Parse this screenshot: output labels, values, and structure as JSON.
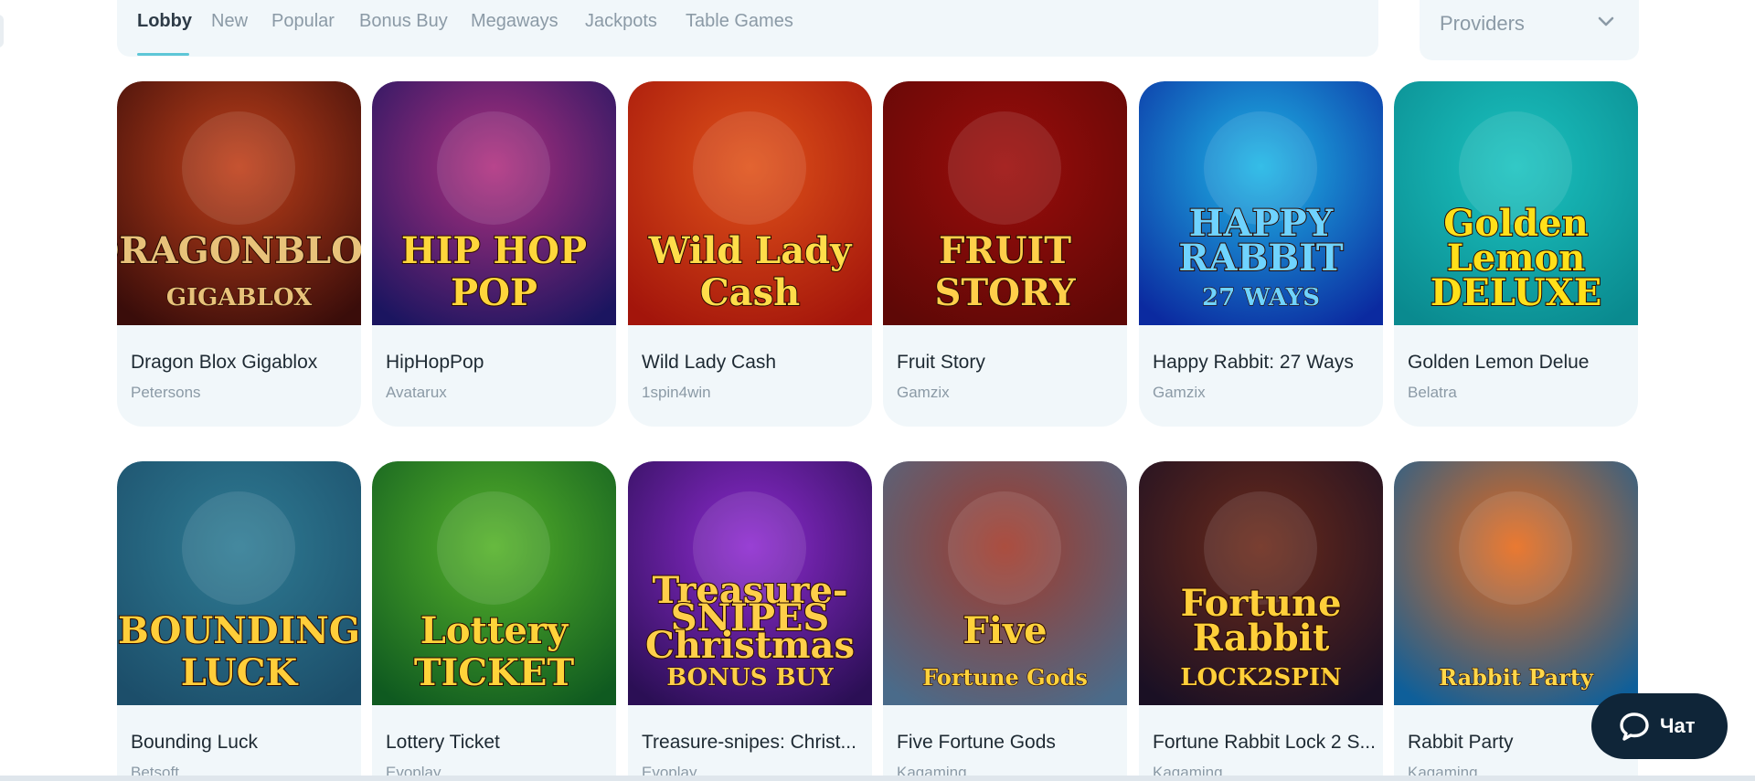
{
  "tabs": [
    {
      "label": "Lobby",
      "active": true
    },
    {
      "label": "New"
    },
    {
      "label": "Popular"
    },
    {
      "label": "Bonus Buy"
    },
    {
      "label": "Megaways"
    },
    {
      "label": "Jackpots"
    },
    {
      "label": "Table Games"
    }
  ],
  "providers_dropdown": {
    "label": "Providers",
    "icon": "chevron-down-icon"
  },
  "games": [
    {
      "name": "Dragon Blox Gigablox",
      "provider": "Petersons",
      "thumb_text": [
        "DRAGONBLOX",
        "GIGABLOX"
      ],
      "colors": [
        "#3a0d0a",
        "#c0401a"
      ],
      "text_color": "#e8c27a"
    },
    {
      "name": "HipHopPop",
      "provider": "Avatarux",
      "thumb_text": [
        "HIP HOP",
        "POP"
      ],
      "colors": [
        "#1b1560",
        "#b0307f"
      ],
      "text_color": "#ffd63b"
    },
    {
      "name": "Wild Lady Cash",
      "provider": "1spin4win",
      "thumb_text": [
        "Wild Lady",
        "Cash"
      ],
      "colors": [
        "#a3150b",
        "#e0531a"
      ],
      "text_color": "#ffdd4a"
    },
    {
      "name": "Fruit Story",
      "provider": "Gamzix",
      "thumb_text": [
        "FRUIT",
        "STORY"
      ],
      "colors": [
        "#5e0806",
        "#9c0d0b"
      ],
      "text_color": "#ffcf4a"
    },
    {
      "name": "Happy Rabbit: 27 Ways",
      "provider": "Gamzix",
      "thumb_text": [
        "HAPPY",
        "RABBIT",
        "27 WAYS"
      ],
      "colors": [
        "#0b2aa0",
        "#1fb7e6"
      ],
      "text_color": "#6fd3ff"
    },
    {
      "name": "Golden Lemon Delue",
      "provider": "Belatra",
      "thumb_text": [
        "Golden",
        "Lemon",
        "DELUXE"
      ],
      "colors": [
        "#0a8a8f",
        "#1bc3c0"
      ],
      "text_color": "#ffe01a"
    },
    {
      "name": "Bounding Luck",
      "provider": "Betsoft",
      "thumb_text": [
        "BOUNDING",
        "LUCK"
      ],
      "colors": [
        "#1c4e6a",
        "#2f7c94"
      ],
      "text_color": "#ffce3a"
    },
    {
      "name": "Lottery Ticket",
      "provider": "Evoplay",
      "thumb_text": [
        "Lottery",
        "TICKET"
      ],
      "colors": [
        "#0f5a20",
        "#56b22a"
      ],
      "text_color": "#ffd33a"
    },
    {
      "name": "Treasure-snipes: Christ...",
      "provider": "Evoplay",
      "thumb_text": [
        "Treasure-",
        "SNIPES",
        "Christmas",
        "BONUS BUY"
      ],
      "colors": [
        "#2b0f55",
        "#8e2bd0"
      ],
      "text_color": "#ffcf4a"
    },
    {
      "name": "Five Fortune Gods",
      "provider": "Kagaming",
      "thumb_text": [
        "Five",
        "Fortune Gods"
      ],
      "colors": [
        "#4a6b8a",
        "#a23a2a"
      ],
      "text_color": "#ffd23b"
    },
    {
      "name": "Fortune Rabbit Lock 2 S...",
      "provider": "Kagaming",
      "thumb_text": [
        "Fortune",
        "Rabbit",
        "LOCK2SPIN"
      ],
      "colors": [
        "#1a1024",
        "#6b2a1a"
      ],
      "text_color": "#ffcf3a"
    },
    {
      "name": "Rabbit Party",
      "provider": "Kagaming",
      "thumb_text": [
        "Rabbit Party"
      ],
      "colors": [
        "#0e5f9a",
        "#e86a1a"
      ],
      "text_color": "#ffd84a"
    }
  ],
  "chat": {
    "label": "Чат",
    "icon": "chat-bubble-icon"
  }
}
